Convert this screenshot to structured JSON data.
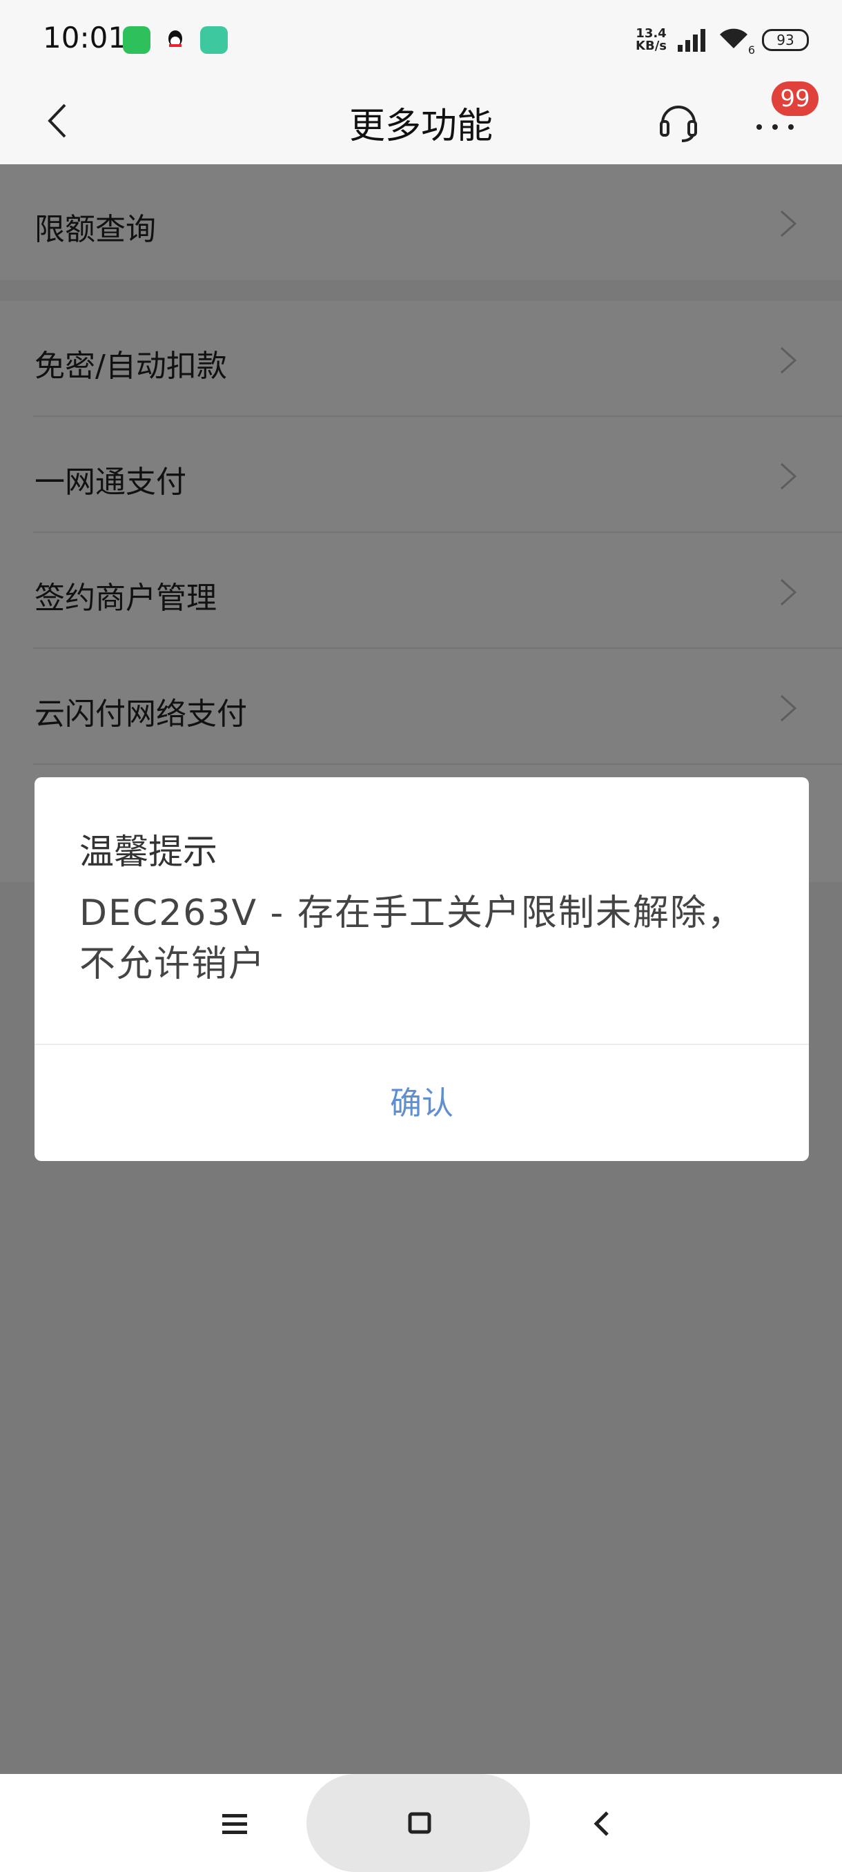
{
  "status_bar": {
    "time": "10:01",
    "net_speed_value": "13.4",
    "net_speed_unit": "KB/s",
    "wifi_label": "6",
    "battery": "93"
  },
  "header": {
    "title": "更多功能",
    "badge_count": "99"
  },
  "list": {
    "group1": [
      {
        "label": "限额查询"
      }
    ],
    "group2": [
      {
        "label": "免密/自动扣款"
      },
      {
        "label": "一网通支付"
      },
      {
        "label": "签约商户管理"
      },
      {
        "label": "云闪付网络支付"
      }
    ]
  },
  "dialog": {
    "title": "温馨提示",
    "message": "DEC263V - 存在手工关户限制未解除，不允许销户",
    "confirm_label": "确认"
  },
  "colors": {
    "badge": "#e0413b",
    "confirm": "#5f8fd1"
  }
}
